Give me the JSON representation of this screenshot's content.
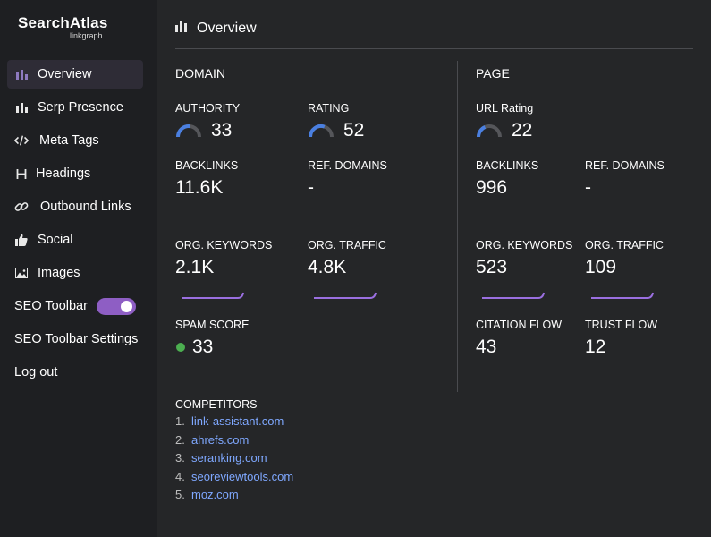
{
  "logo": {
    "main": "SearchAtlas",
    "sub": "linkgraph"
  },
  "sidebar": {
    "items": [
      {
        "label": "Overview",
        "icon": "bar-chart-icon",
        "active": true
      },
      {
        "label": "Serp Presence",
        "icon": "bar-chart-icon"
      },
      {
        "label": "Meta Tags",
        "icon": "code-icon"
      },
      {
        "label": "Headings",
        "icon": "heading-icon"
      },
      {
        "label": "Outbound Links",
        "icon": "link-icon"
      },
      {
        "label": "Social",
        "icon": "thumbs-up-icon"
      },
      {
        "label": "Images",
        "icon": "image-icon"
      }
    ],
    "seo_toolbar": {
      "label": "SEO Toolbar",
      "enabled": true
    },
    "settings_label": "SEO Toolbar Settings",
    "logout_label": "Log out"
  },
  "header": {
    "title": "Overview"
  },
  "domain": {
    "title": "DOMAIN",
    "authority": {
      "label": "AUTHORITY",
      "value": "33"
    },
    "rating": {
      "label": "RATING",
      "value": "52"
    },
    "backlinks": {
      "label": "BACKLINKS",
      "value": "11.6K"
    },
    "ref_domains": {
      "label": "REF. DOMAINS",
      "value": "-"
    },
    "org_keywords": {
      "label": "ORG. KEYWORDS",
      "value": "2.1K"
    },
    "org_traffic": {
      "label": "ORG. TRAFFIC",
      "value": "4.8K"
    },
    "spam_score": {
      "label": "SPAM SCORE",
      "value": "33"
    }
  },
  "page": {
    "title": "PAGE",
    "url_rating": {
      "label": "URL Rating",
      "value": "22"
    },
    "backlinks": {
      "label": "BACKLINKS",
      "value": "996"
    },
    "ref_domains": {
      "label": "REF. DOMAINS",
      "value": "-"
    },
    "org_keywords": {
      "label": "ORG. KEYWORDS",
      "value": "523"
    },
    "org_traffic": {
      "label": "ORG. TRAFFIC",
      "value": "109"
    },
    "citation_flow": {
      "label": "CITATION FLOW",
      "value": "43"
    },
    "trust_flow": {
      "label": "TRUST FLOW",
      "value": "12"
    }
  },
  "competitors": {
    "title": "COMPETITORS",
    "items": [
      {
        "num": "1.",
        "domain": "link-assistant.com"
      },
      {
        "num": "2.",
        "domain": "ahrefs.com"
      },
      {
        "num": "3.",
        "domain": "seranking.com"
      },
      {
        "num": "4.",
        "domain": "seoreviewtools.com"
      },
      {
        "num": "5.",
        "domain": "moz.com"
      }
    ]
  },
  "colors": {
    "accent": "#8e5ec4",
    "gauge_fill": "#4a7fe0",
    "gauge_track": "#55565a",
    "sparkline": "#9a6fe0",
    "link": "#7fa8ff",
    "spam_dot": "#4caf50"
  }
}
